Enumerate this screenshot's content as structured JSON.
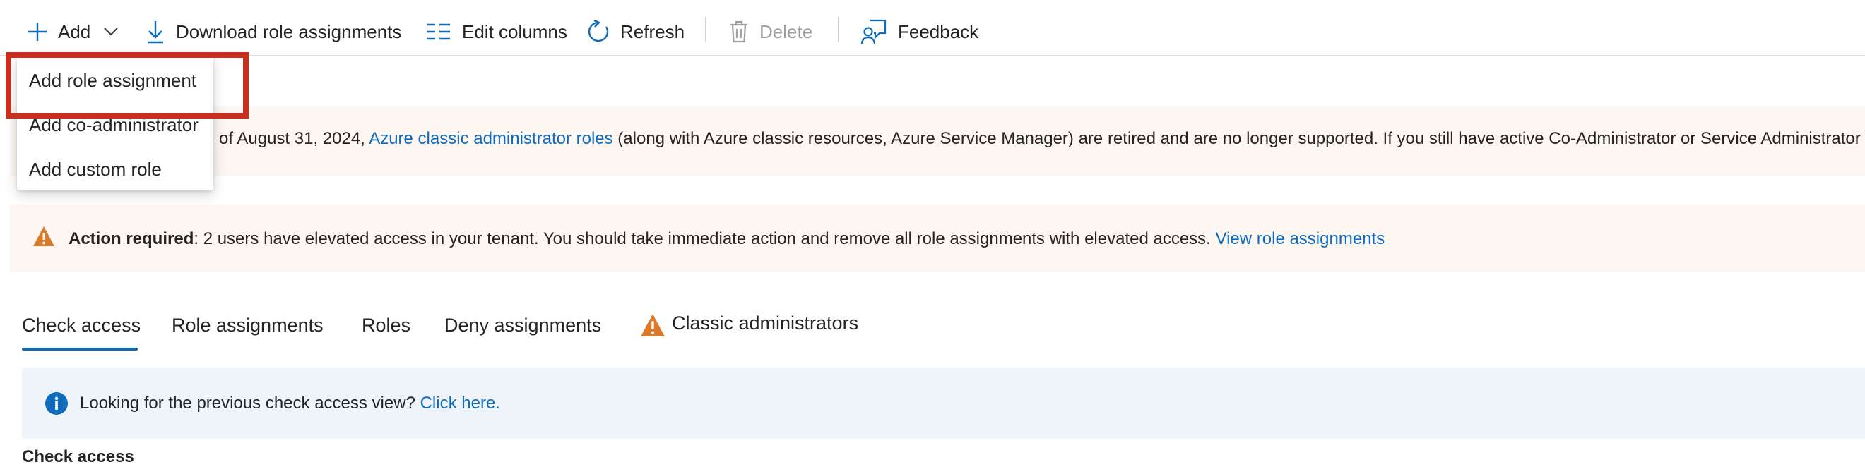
{
  "toolbar": {
    "add_label": "Add",
    "download_label": "Download role assignments",
    "edit_columns_label": "Edit columns",
    "refresh_label": "Refresh",
    "delete_label": "Delete",
    "feedback_label": "Feedback"
  },
  "add_menu": {
    "items": [
      {
        "label": "Add role assignment"
      },
      {
        "label": "Add co-administrator"
      },
      {
        "label": "Add custom role"
      }
    ]
  },
  "retirement_banner": {
    "text_before": "of August 31, 2024, ",
    "link": "Azure classic administrator roles",
    "text_after": " (along with Azure classic resources, Azure Service Manager) are retired and are no longer supported. If you still have active Co-Administrator or Service Administrator ro"
  },
  "action_banner": {
    "bold": "Action required",
    "text": ": 2 users have elevated access in your tenant. You should take immediate action and remove all role assignments with elevated access. ",
    "link": "View role assignments"
  },
  "tabs": [
    {
      "label": "Check access",
      "selected": true
    },
    {
      "label": "Role assignments",
      "selected": false
    },
    {
      "label": "Roles",
      "selected": false
    },
    {
      "label": "Deny assignments",
      "selected": false
    },
    {
      "label": "Classic administrators",
      "selected": false,
      "icon": "warning-icon"
    }
  ],
  "info_banner": {
    "text": "Looking for the previous check access view? ",
    "link": "Click here."
  },
  "section": {
    "title": "Check access"
  },
  "colors": {
    "accent": "#0f6cbd",
    "warning": "#da7a2c",
    "highlight": "#c7301f",
    "warning_bg": "#fdf6f1",
    "info_bg": "#eff4fb"
  }
}
